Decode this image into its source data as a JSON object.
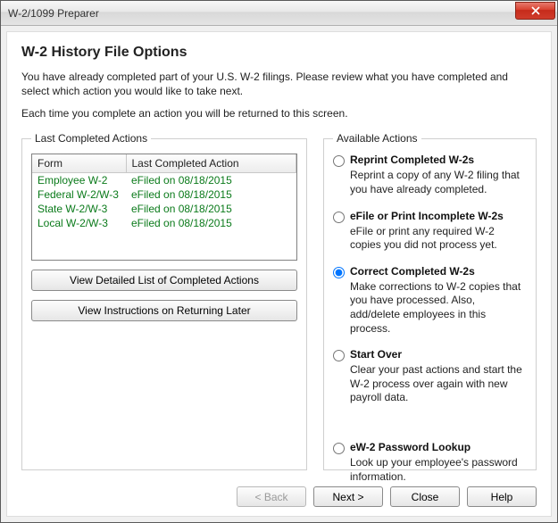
{
  "window": {
    "title": "W-2/1099 Preparer"
  },
  "heading": "W-2 History File Options",
  "intro": "You have already completed part of your U.S. W-2 filings. Please review what you have completed and select which action you would like to take next.",
  "intro2": "Each time you complete an action you will be returned to this screen.",
  "left_group": {
    "legend": "Last Completed Actions",
    "columns": {
      "form": "Form",
      "action": "Last Completed Action"
    },
    "rows": [
      {
        "form": "Employee W-2",
        "action": "eFiled on 08/18/2015"
      },
      {
        "form": "Federal W-2/W-3",
        "action": "eFiled on 08/18/2015"
      },
      {
        "form": "State W-2/W-3",
        "action": "eFiled on 08/18/2015"
      },
      {
        "form": "Local W-2/W-3",
        "action": "eFiled on 08/18/2015"
      }
    ],
    "view_detailed": "View Detailed List of Completed Actions",
    "view_instructions": "View Instructions on Returning Later"
  },
  "right_group": {
    "legend": "Available Actions",
    "options": [
      {
        "id": "reprint",
        "label": "Reprint Completed W-2s",
        "desc": "Reprint a copy of any W-2 filing that you have already completed."
      },
      {
        "id": "efile",
        "label": "eFile or Print Incomplete W-2s",
        "desc": "eFile or print any required W-2 copies you did not process yet."
      },
      {
        "id": "correct",
        "label": "Correct Completed W-2s",
        "desc": "Make corrections to W-2 copies that you have processed. Also, add/delete employees in this process."
      },
      {
        "id": "startover",
        "label": "Start Over",
        "desc": "Clear your past actions and start the W-2 process over again with new payroll data."
      },
      {
        "id": "ew2",
        "label": "eW-2 Password Lookup",
        "desc": "Look up your employee's password information."
      }
    ],
    "selected": "correct"
  },
  "footer": {
    "back": "< Back",
    "next": "Next >",
    "close": "Close",
    "help": "Help"
  }
}
